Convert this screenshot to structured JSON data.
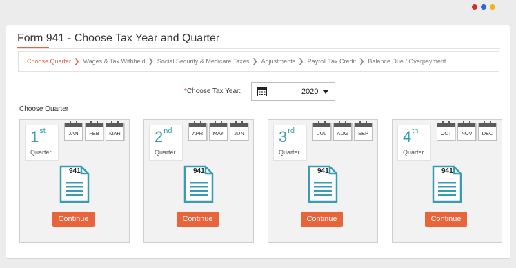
{
  "window": {
    "dots": [
      {
        "name": "red",
        "color": "#d62b2b"
      },
      {
        "name": "blue",
        "color": "#2f63d8"
      },
      {
        "name": "yellow",
        "color": "#f0b41d"
      }
    ]
  },
  "page": {
    "title": "Form 941 - Choose Tax Year and Quarter",
    "accent": "#e8643b"
  },
  "breadcrumb": [
    {
      "label": "Choose Quarter",
      "active": true
    },
    {
      "label": "Wages & Tax Withheld",
      "active": false
    },
    {
      "label": "Social Security & Medicare Taxes",
      "active": false
    },
    {
      "label": "Adjustments",
      "active": false
    },
    {
      "label": "Payroll Tax Credit",
      "active": false
    },
    {
      "label": "Balance Due / Overpayment",
      "active": false
    }
  ],
  "tax_year": {
    "required_mark": "*",
    "label": "Choose Tax Year:",
    "value": "2020",
    "icon": "calendar-icon"
  },
  "choose_quarter_label": "Choose Quarter",
  "quarters": [
    {
      "num": "1",
      "suffix": "st",
      "label": "Quarter",
      "months": [
        "JAN",
        "FEB",
        "MAR"
      ],
      "form": "941",
      "button": "Continue"
    },
    {
      "num": "2",
      "suffix": "nd",
      "label": "Quarter",
      "months": [
        "APR",
        "MAY",
        "JUN"
      ],
      "form": "941",
      "button": "Continue"
    },
    {
      "num": "3",
      "suffix": "rd",
      "label": "Quarter",
      "months": [
        "JUL",
        "AUG",
        "SEP"
      ],
      "form": "941",
      "button": "Continue"
    },
    {
      "num": "4",
      "suffix": "th",
      "label": "Quarter",
      "months": [
        "OCT",
        "NOV",
        "DEC"
      ],
      "form": "941",
      "button": "Continue"
    }
  ]
}
